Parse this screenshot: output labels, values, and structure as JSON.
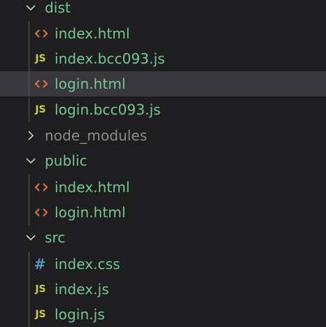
{
  "colors": {
    "background": "#1e1e21",
    "selected_row": "#37373d",
    "indent_guide": "#585858",
    "git_untracked_text": "#73c991",
    "ignored_text": "#8b8b8b",
    "html_icon": "#e37933",
    "js_icon": "#cbcb41",
    "css_icon": "#519aba"
  },
  "tree": {
    "dist": {
      "label": "dist",
      "state": "expanded",
      "children": [
        {
          "label": "index.html",
          "icon": "html-file-icon"
        },
        {
          "label": "index.bcc093.js",
          "icon": "js-file-icon",
          "icon_text": "JS"
        },
        {
          "label": "login.html",
          "icon": "html-file-icon",
          "selected": true
        },
        {
          "label": "login.bcc093.js",
          "icon": "js-file-icon",
          "icon_text": "JS"
        }
      ]
    },
    "node_modules": {
      "label": "node_modules",
      "state": "collapsed"
    },
    "public": {
      "label": "public",
      "state": "expanded",
      "children": [
        {
          "label": "index.html",
          "icon": "html-file-icon"
        },
        {
          "label": "login.html",
          "icon": "html-file-icon"
        }
      ]
    },
    "src": {
      "label": "src",
      "state": "expanded",
      "children": [
        {
          "label": "index.css",
          "icon": "css-file-icon",
          "icon_text": "#"
        },
        {
          "label": "index.js",
          "icon": "js-file-icon",
          "icon_text": "JS"
        },
        {
          "label": "login.js",
          "icon": "js-file-icon",
          "icon_text": "JS"
        }
      ]
    }
  }
}
